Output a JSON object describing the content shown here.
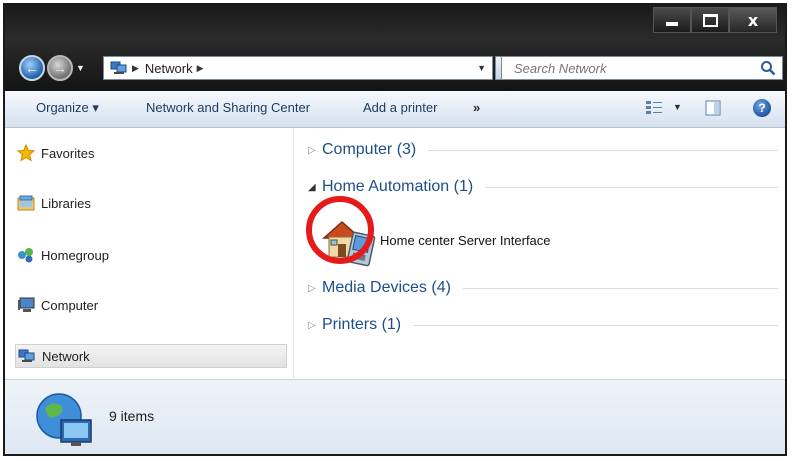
{
  "window": {
    "controls": {
      "minimize": "–",
      "maximize": "□",
      "close": "x"
    }
  },
  "address": {
    "location": "Network",
    "search_placeholder": "Search Network"
  },
  "toolbar": {
    "organize": "Organize ▾",
    "network_sharing": "Network and Sharing Center",
    "add_printer": "Add a printer",
    "more": "»"
  },
  "sidebar": {
    "items": [
      {
        "label": "Favorites",
        "icon": "star-icon"
      },
      {
        "label": "Libraries",
        "icon": "library-icon"
      },
      {
        "label": "Homegroup",
        "icon": "homegroup-icon"
      },
      {
        "label": "Computer",
        "icon": "computer-icon"
      },
      {
        "label": "Network",
        "icon": "network-icon",
        "selected": true
      }
    ]
  },
  "content": {
    "groups": [
      {
        "label": "Computer (3)",
        "expanded": false
      },
      {
        "label": "Home Automation (1)",
        "expanded": true
      },
      {
        "label": "Media Devices (4)",
        "expanded": false
      },
      {
        "label": "Printers (1)",
        "expanded": false
      }
    ],
    "items": [
      {
        "label": "Home center Server Interface",
        "icon": "house-device-icon",
        "highlighted": true
      }
    ]
  },
  "status": {
    "count": "9 items"
  },
  "colors": {
    "accent": "#1d4e89",
    "highlight": "#e51a1a",
    "titlebar": "#1a1a1a"
  }
}
